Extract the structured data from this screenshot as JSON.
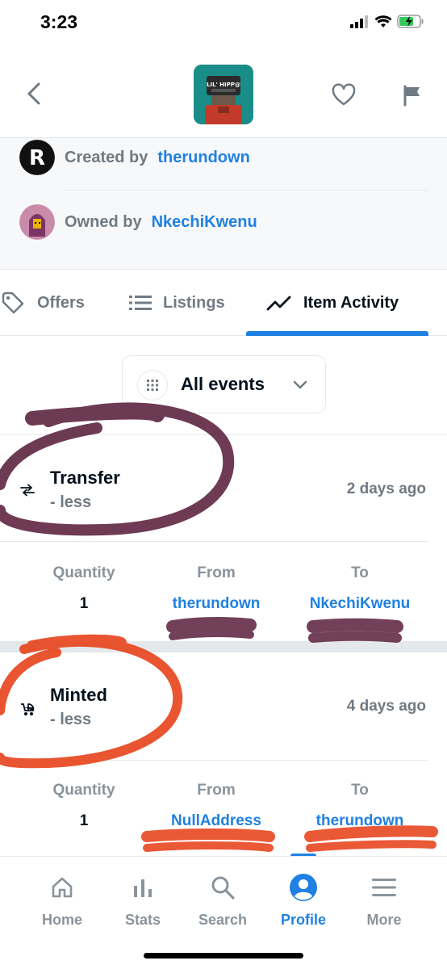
{
  "status_bar": {
    "time": "3:23"
  },
  "top_nav": {
    "thumbnail_text": "LIL' HIPP@"
  },
  "ownership": {
    "created_prefix": "Created by",
    "creator": "therundown",
    "owned_prefix": "Owned by",
    "owner": "NkechiKwenu"
  },
  "tabs": [
    {
      "label": "Offers",
      "icon": "tag-icon"
    },
    {
      "label": "Listings",
      "icon": "list-icon"
    },
    {
      "label": "Item Activity",
      "icon": "activity-icon",
      "active": true
    }
  ],
  "filter": {
    "label": "All events"
  },
  "activity": [
    {
      "event": "Transfer",
      "toggle": "- less",
      "time": "2 days ago",
      "icon": "transfer-arrows-icon",
      "columns": {
        "quantity_label": "Quantity",
        "from_label": "From",
        "to_label": "To"
      },
      "quantity": "1",
      "from": "therundown",
      "to": "NkechiKwenu"
    },
    {
      "event": "Minted",
      "toggle": "- less",
      "time": "4 days ago",
      "icon": "stroller-icon",
      "columns": {
        "quantity_label": "Quantity",
        "from_label": "From",
        "to_label": "To"
      },
      "quantity": "1",
      "from": "NullAddress",
      "to": "therundown"
    }
  ],
  "bottom_nav": [
    {
      "label": "Home",
      "icon": "home-icon"
    },
    {
      "label": "Stats",
      "icon": "stats-icon"
    },
    {
      "label": "Search",
      "icon": "search-icon"
    },
    {
      "label": "Profile",
      "icon": "profile-icon",
      "active": true
    },
    {
      "label": "More",
      "icon": "menu-icon"
    }
  ],
  "colors": {
    "accent": "#2081e2",
    "text_primary": "#04111d",
    "text_secondary": "#707a83",
    "annotation_purple": "#5a1f3c",
    "annotation_orange": "#e8431b"
  }
}
